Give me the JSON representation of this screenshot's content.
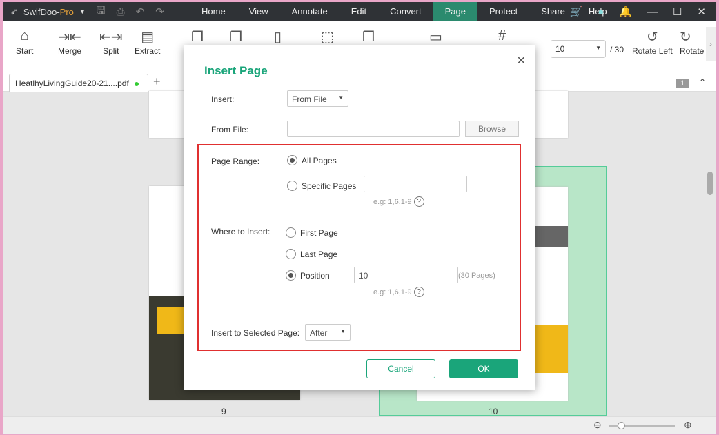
{
  "app": {
    "name": "SwifDoo-",
    "edition": "Pro"
  },
  "menu": [
    "Home",
    "View",
    "Annotate",
    "Edit",
    "Convert",
    "Page",
    "Protect",
    "Share",
    "Help"
  ],
  "active_menu": "Page",
  "ribbon": {
    "start": "Start",
    "merge": "Merge",
    "split": "Split",
    "extract": "Extract",
    "rotate_left": "Rotate Left",
    "rotate_right": "Rotate"
  },
  "page_nav": {
    "current": "10",
    "total": "/ 30"
  },
  "tab": {
    "filename": "HeatlhyLivingGuide20-21....pdf",
    "page_badge": "1"
  },
  "thumbs": {
    "left_label": "9",
    "right_label": "10"
  },
  "dialog": {
    "title": "Insert Page",
    "insert_label": "Insert:",
    "insert_value": "From File",
    "from_file_label": "From File:",
    "from_file_value": "",
    "browse": "Browse",
    "page_range_label": "Page Range:",
    "all_pages": "All Pages",
    "specific_pages": "Specific Pages",
    "specific_value": "",
    "hint1": "e.g: 1,6,1-9",
    "where_label": "Where to Insert:",
    "first_page": "First Page",
    "last_page": "Last Page",
    "position": "Position",
    "position_value": "10",
    "pages_count": "(30 Pages)",
    "hint2": "e.g: 1,6,1-9",
    "selected_label": "Insert to Selected Page:",
    "selected_value": "After",
    "cancel": "Cancel",
    "ok": "OK",
    "page_range_selected": "All Pages",
    "where_selected": "Position"
  },
  "colors": {
    "accent": "#1aa57a",
    "highlight": "#e03030",
    "titlebar": "#2f3236"
  }
}
